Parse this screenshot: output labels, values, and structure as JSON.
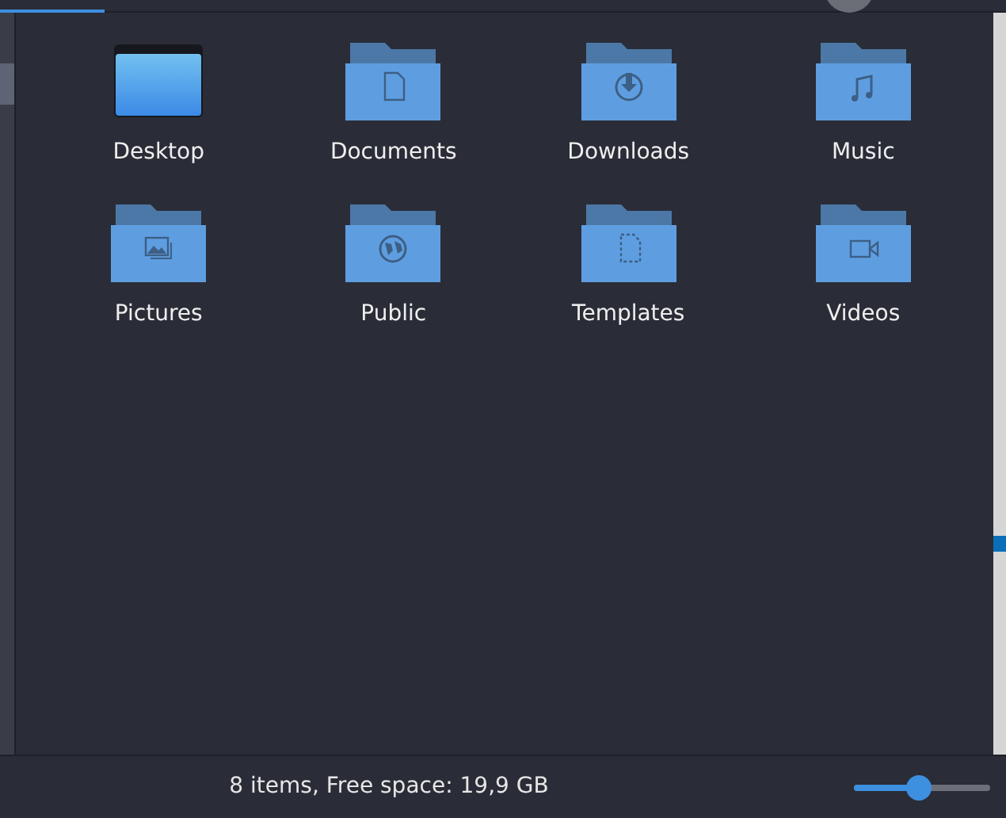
{
  "items": [
    {
      "label": "Desktop",
      "kind": "desktop"
    },
    {
      "label": "Documents",
      "kind": "document"
    },
    {
      "label": "Downloads",
      "kind": "download"
    },
    {
      "label": "Music",
      "kind": "music"
    },
    {
      "label": "Pictures",
      "kind": "pictures"
    },
    {
      "label": "Public",
      "kind": "public"
    },
    {
      "label": "Templates",
      "kind": "template"
    },
    {
      "label": "Videos",
      "kind": "video"
    }
  ],
  "status_bar": {
    "text": "8 items, Free space: 19,9 GB",
    "zoom": {
      "level": 0.48
    }
  }
}
